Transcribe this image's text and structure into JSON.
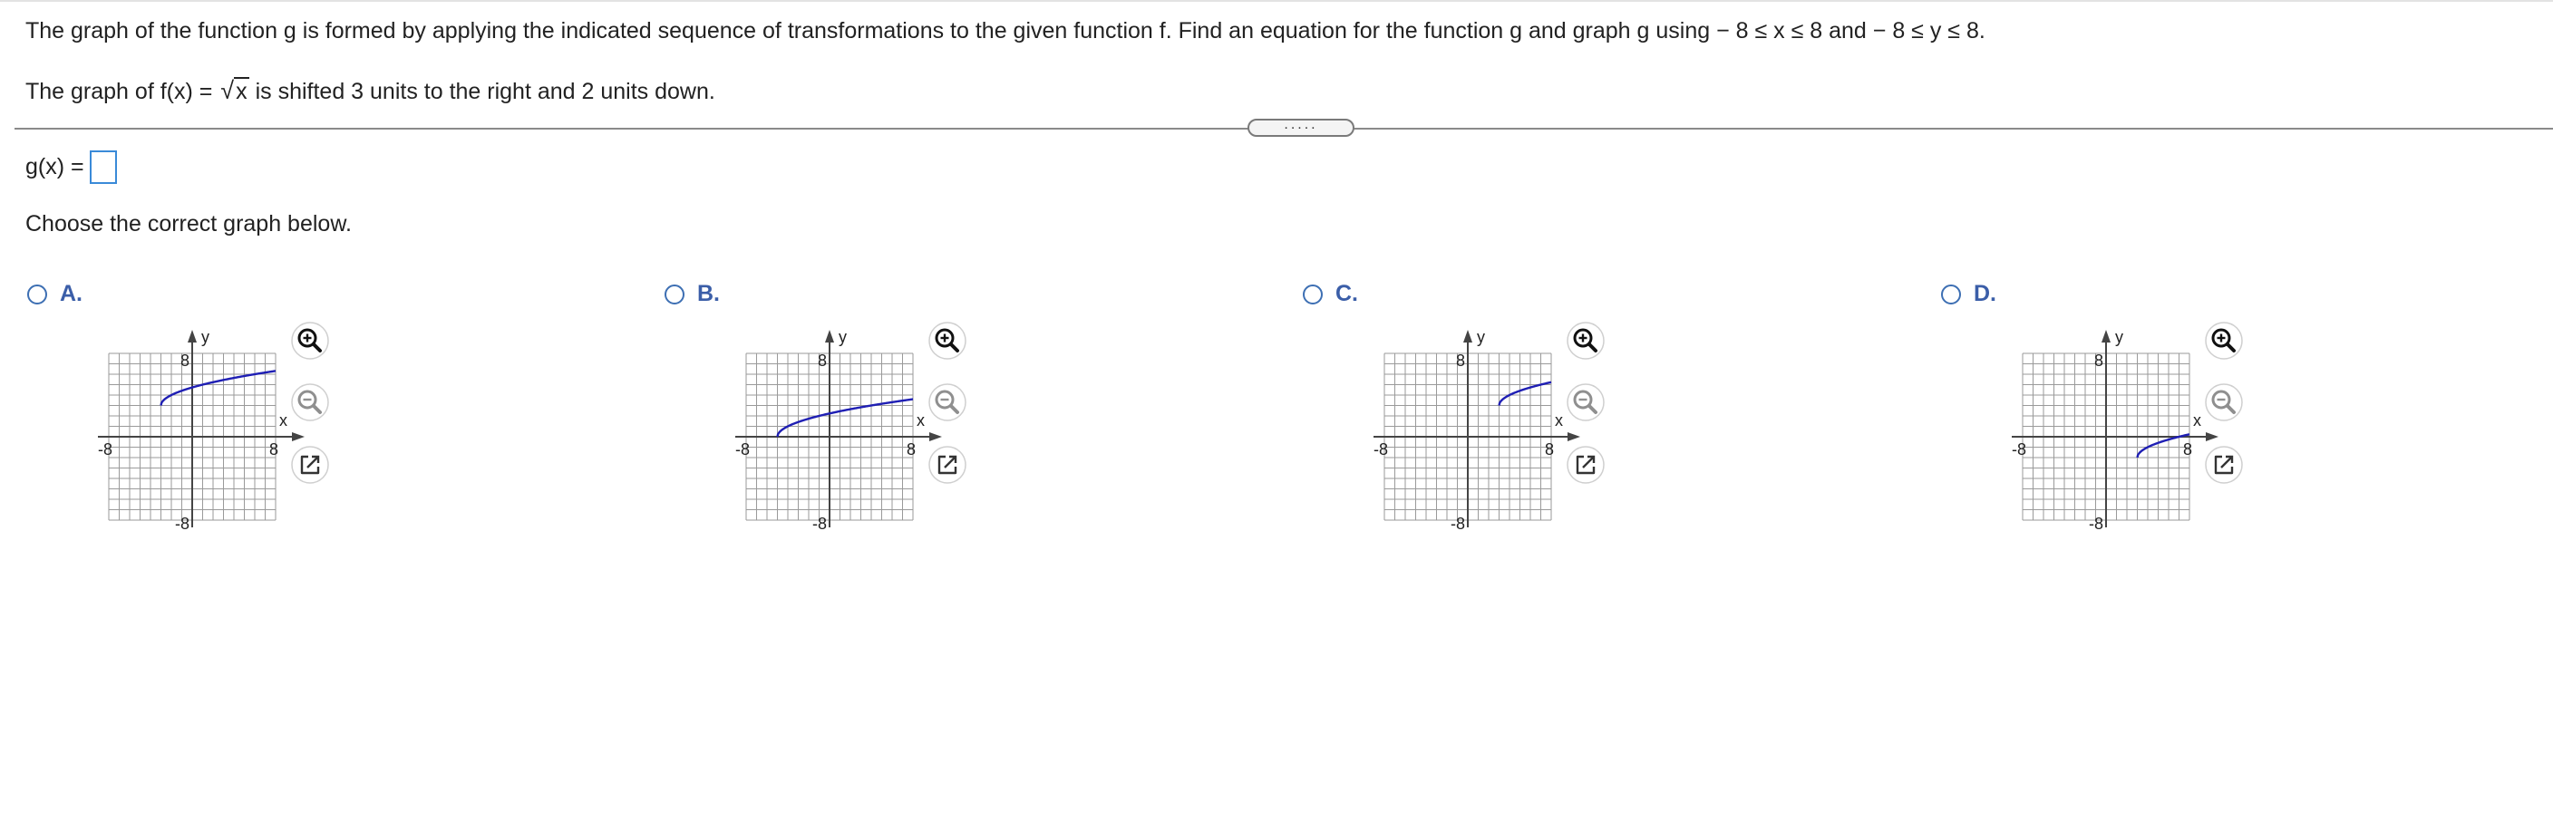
{
  "question": {
    "prompt": "The graph of the function g is formed by applying the indicated sequence of transformations to the given function f. Find an equation for the function g and graph g using − 8 ≤ x ≤ 8 and − 8 ≤ y ≤ 8.",
    "sub_prefix": "The graph of f(x) = ",
    "sub_radicand": "x",
    "sub_suffix": " is shifted 3 units to the right and 2 units down.",
    "expander_label": ".....",
    "answer_label": "g(x) =",
    "answer_value": "",
    "instruction": "Choose the correct graph below."
  },
  "axis": {
    "x_label": "x",
    "y_label": "y",
    "tick_pos": "8",
    "tick_neg": "-8",
    "range": [
      -8,
      8
    ]
  },
  "colors": {
    "curve": "#1f1fb4",
    "grid": "#9a9a9a",
    "axis": "#444444",
    "radio": "#3d6fb3",
    "label": "#3b5ea8",
    "tool": "#333333",
    "tool_ring": "#cfcfcf"
  },
  "tool_icons": [
    "zoom-in-icon",
    "zoom-out-icon",
    "open-new-window-icon"
  ],
  "options": [
    {
      "label": "A.",
      "shift_h": -3,
      "shift_v": 3
    },
    {
      "label": "B.",
      "shift_h": -5,
      "shift_v": 0
    },
    {
      "label": "C.",
      "shift_h": 3,
      "shift_v": 3
    },
    {
      "label": "D.",
      "shift_h": 3,
      "shift_v": -2
    }
  ]
}
